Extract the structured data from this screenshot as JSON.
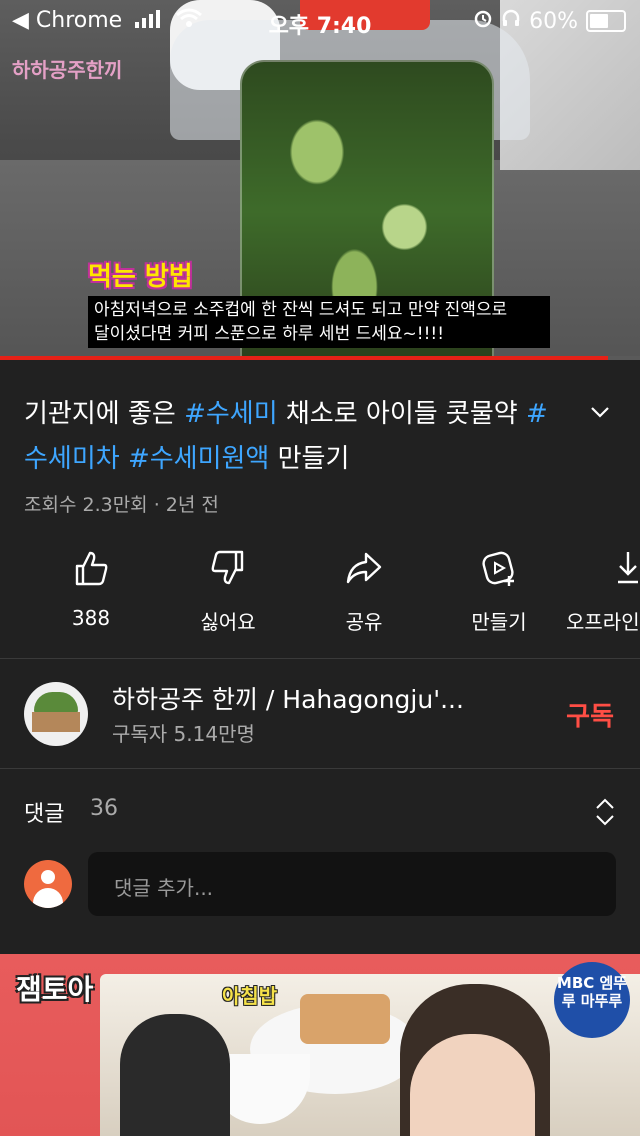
{
  "status_bar": {
    "back_app": "◀ Chrome",
    "time": "오후 7:40",
    "battery": "60%"
  },
  "video": {
    "watermark": "하하공주한끼",
    "subtitle_heading": "먹는 방법",
    "subtitle_line1": "아침저녁으로 소주컵에 한 잔씩 드셔도 되고 만약 진액으로",
    "subtitle_line2": "달이셨다면 커피 스푼으로 하루 세번 드세요~!!!!",
    "progress_fraction": 0.95,
    "progress_color": "#e62117"
  },
  "title": {
    "p1": "기관지에 좋은 ",
    "tag1": "#수세미",
    "p2": " 채소로 아이들 콧물약 ",
    "tag2": "#수세미차",
    "p3": " ",
    "tag3": "#수세미원액",
    "p4": " 만들기",
    "tag_color": "#3ea6ff"
  },
  "meta": "조회수 2.3만회 · 2년 전",
  "actions": [
    {
      "icon": "thumbs-up-icon",
      "label": "388"
    },
    {
      "icon": "thumbs-down-icon",
      "label": "싫어요"
    },
    {
      "icon": "share-icon",
      "label": "공유"
    },
    {
      "icon": "remix-icon",
      "label": "만들기"
    },
    {
      "icon": "download-icon",
      "label": "오프라인"
    }
  ],
  "channel": {
    "name": "하하공주 한끼 / Hahagongju'...",
    "subscribers": "구독자 5.14만명",
    "subscribe_label": "구독",
    "subscribe_color": "#ff4e45"
  },
  "comments": {
    "label": "댓글",
    "count": "36",
    "placeholder": "댓글 추가..."
  },
  "next_video": {
    "title_overlay": "잼토아",
    "caption": "아침밥",
    "badge": "MBC 엠뚜루 마뚜루"
  }
}
